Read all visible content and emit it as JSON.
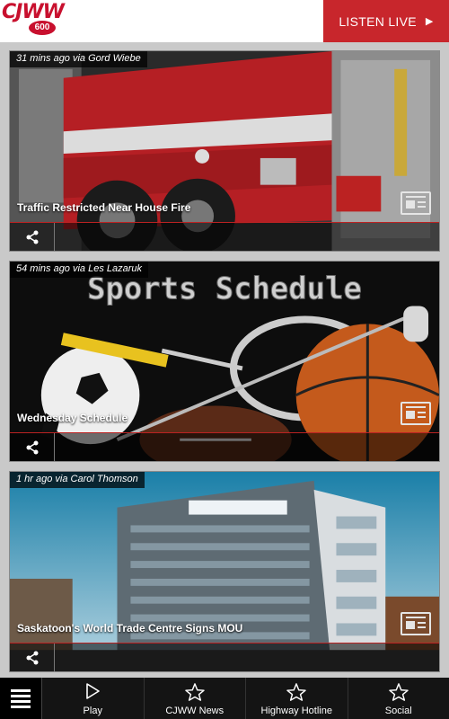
{
  "header": {
    "logo_text": "CJWW",
    "logo_sub": "600",
    "listen_label": "LISTEN LIVE",
    "brand_color": "#c8262c"
  },
  "cards": [
    {
      "meta": "31 mins ago via Gord Wiebe",
      "headline": "Traffic Restricted Near House Fire",
      "image": "fire-truck-photo"
    },
    {
      "meta": "54 mins ago via Les Lazaruk",
      "headline": "Wednesday Schedule",
      "image_title": "Sports Schedule",
      "image": "sports-balls-photo"
    },
    {
      "meta": "1 hr ago via Carol Thomson",
      "headline": "Saskatoon's World Trade Centre Signs MOU",
      "image": "office-building-photo"
    }
  ],
  "nav": {
    "menu_icon": "hamburger-icon",
    "items": [
      {
        "label": "Play",
        "icon": "play-icon"
      },
      {
        "label": "CJWW News",
        "icon": "star-icon"
      },
      {
        "label": "Highway Hotline",
        "icon": "star-icon"
      },
      {
        "label": "Social",
        "icon": "star-icon"
      }
    ]
  }
}
